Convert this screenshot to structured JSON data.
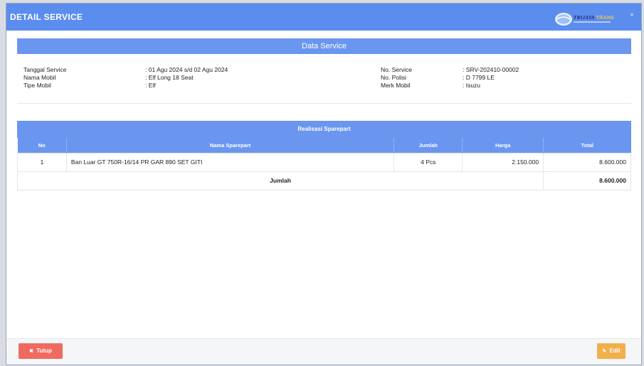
{
  "modal": {
    "title": "DETAIL SERVICE",
    "brand": {
      "name": "TRIJAYA",
      "sub": "TRANS",
      "close_icon": "×"
    }
  },
  "data_service": {
    "heading": "Data Service",
    "fields_left": [
      {
        "label": "Tanggal Service",
        "value": ": 01 Agu 2024 s/d 02 Agu 2024"
      },
      {
        "label": "Nama Mobil",
        "value": ": Elf Long 18 Seat"
      },
      {
        "label": "Tipe Mobil",
        "value": ": Elf"
      }
    ],
    "fields_right": [
      {
        "label": "No. Service",
        "value": ": SRV-202410-00002"
      },
      {
        "label": "No. Polisi",
        "value": ": D 7799 LE"
      },
      {
        "label": "Merk Mobil",
        "value": ": Isuzu"
      }
    ]
  },
  "sparepart": {
    "heading": "Realisasi Sparepart",
    "columns": [
      "No",
      "Nama Sparepart",
      "Jumlah",
      "Harga",
      "Total"
    ],
    "rows": [
      {
        "no": "1",
        "name": "Ban Luar GT 750R-16/14 PR GAR 890 SET GITI",
        "qty": "4 Pcs",
        "price": "2.150.000",
        "total": "8.600.000"
      }
    ],
    "summary": {
      "label": "Jumlah",
      "total": "8.600.000"
    }
  },
  "footer": {
    "close_label": "Tutup",
    "close_icon": "✖",
    "edit_label": "Edit",
    "edit_icon": "✎"
  },
  "colors": {
    "header": "#5b8def",
    "section_bar": "#6a96f0",
    "close_button": "#f06b5f",
    "edit_button": "#f1b04b"
  }
}
